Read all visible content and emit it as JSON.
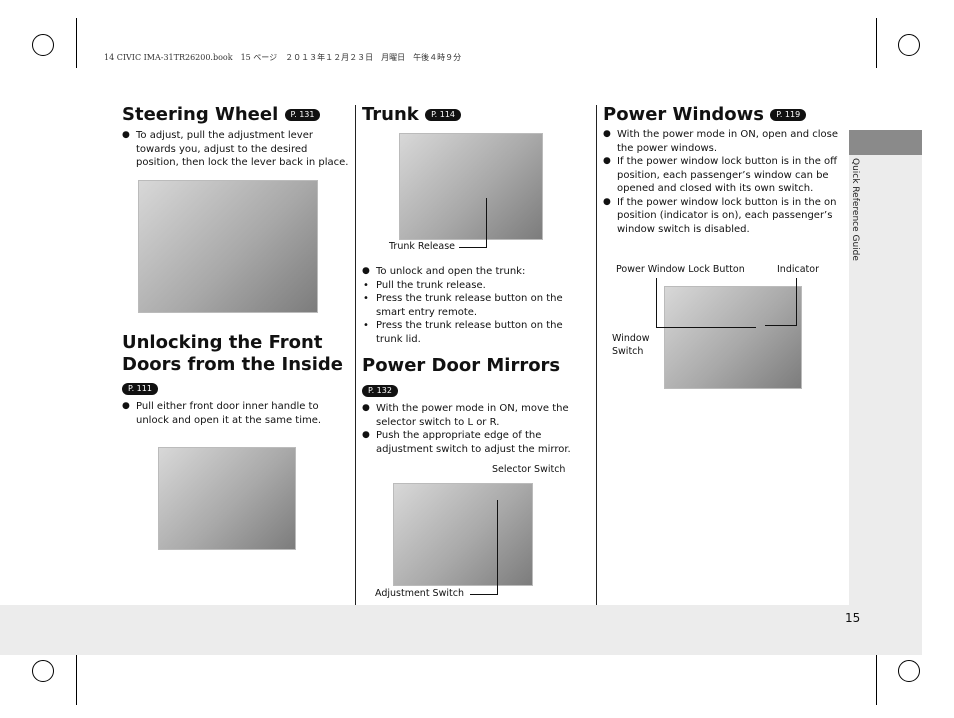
{
  "header": "14 CIVIC IMA-31TR26200.book　15 ページ　２０１３年１２月２３日　月曜日　午後４時９分",
  "side_label": "Quick Reference Guide",
  "page_number": "15",
  "steering": {
    "title": "Steering Wheel",
    "ref": "P. 131",
    "bullets": [
      "To adjust, pull the adjustment lever towards you, adjust to the desired position, then lock the lever back in place."
    ]
  },
  "unlocking": {
    "title": "Unlocking the Front Doors from the Inside",
    "ref": "P. 111",
    "bullets": [
      "Pull either front door inner handle to unlock and open it at the same time."
    ]
  },
  "trunk": {
    "title": "Trunk",
    "ref": "P. 114",
    "caption": "Trunk Release",
    "bullets": [
      "To unlock and open the trunk:"
    ],
    "sub": [
      "Pull the trunk release.",
      "Press the trunk release button on the smart entry remote.",
      "Press the trunk release button on the trunk lid."
    ]
  },
  "mirrors": {
    "title": "Power Door Mirrors",
    "ref": "P. 132",
    "bullets": [
      "With the power mode in ON, move the selector switch to L or R.",
      "Push the appropriate edge of the adjustment switch to adjust the mirror."
    ],
    "caption_selector": "Selector Switch",
    "caption_adjust": "Adjustment Switch"
  },
  "windows": {
    "title": "Power Windows",
    "ref": "P. 119",
    "bullets": [
      "With the power mode in ON, open and close the power windows.",
      "If the power window lock button is in the off position, each passenger’s window can be opened and closed with its own switch.",
      "If the power window lock button is in the on position (indicator is on), each passenger’s window switch is disabled."
    ],
    "caption_lock": "Power Window Lock Button",
    "caption_indicator": "Indicator",
    "caption_switch": "Window Switch"
  }
}
